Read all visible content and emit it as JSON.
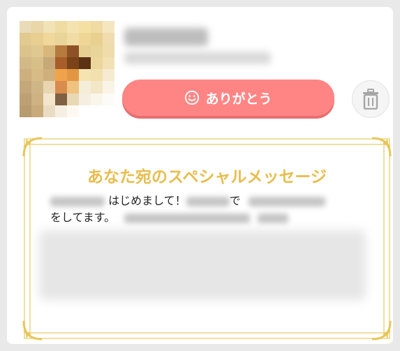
{
  "actions": {
    "thanks_label": "ありがとう",
    "thanks_icon": "smile-icon",
    "delete_icon": "trash-icon"
  },
  "message": {
    "title": "あなた宛のスペシャルメッセージ",
    "line1_visible": "はじめまして！",
    "line1_suffix": "で",
    "line2_start": "をしてます。"
  },
  "colors": {
    "button_bg": "#ff8585",
    "title_gold": "#e8bd4d",
    "frame_gold": "#f0dfa0"
  }
}
